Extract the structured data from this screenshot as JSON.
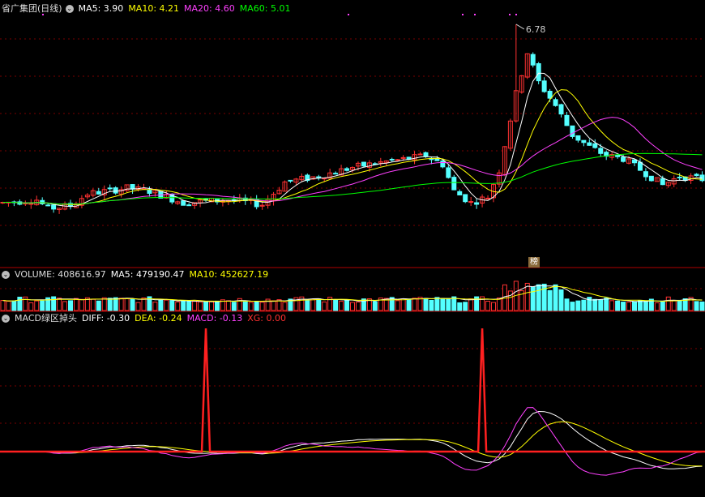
{
  "main": {
    "title": "省广集团(日线)",
    "ma5_label": "MA5: 3.90",
    "ma10_label": "MA10: 4.21",
    "ma20_label": "MA20: 4.60",
    "ma60_label": "MA60: 5.01",
    "high_label": "6.78",
    "badge_label": "榜"
  },
  "volume": {
    "label": "VOLUME: 408616.97",
    "ma5_label": "MA5: 479190.47",
    "ma10_label": "MA10: 452627.19"
  },
  "macd": {
    "title": "MACD绿区掉头",
    "diff_label": "DIFF: -0.30",
    "dea_label": "DEA: -0.24",
    "macd_label": "MACD: -0.13",
    "xg_label": "XG: 0.00"
  },
  "colors": {
    "up": "#ff3232",
    "down": "#54ffff",
    "ma5": "#ffffff",
    "ma10": "#ffff00",
    "ma20": "#ff40ff",
    "ma60": "#00ff00",
    "grid": "#7a0000",
    "signal": "#ff2020"
  },
  "chart_data": [
    {
      "type": "candlestick",
      "title": "省广集团(日线)",
      "series": [
        {
          "name": "MA5",
          "last": 3.9
        },
        {
          "name": "MA10",
          "last": 4.21
        },
        {
          "name": "MA20",
          "last": 4.6
        },
        {
          "name": "MA60",
          "last": 5.01
        }
      ],
      "annotations": [
        {
          "text": "6.78",
          "meaning": "period high"
        }
      ]
    },
    {
      "type": "bar",
      "title": "VOLUME",
      "series": [
        {
          "name": "VOLUME",
          "last": 408616.97
        },
        {
          "name": "MA5",
          "last": 479190.47
        },
        {
          "name": "MA10",
          "last": 452627.19
        }
      ]
    },
    {
      "type": "line",
      "title": "MACD绿区掉头",
      "series": [
        {
          "name": "DIFF",
          "last": -0.3
        },
        {
          "name": "DEA",
          "last": -0.24
        },
        {
          "name": "MACD",
          "last": -0.13
        },
        {
          "name": "XG",
          "last": 0.0
        }
      ]
    }
  ]
}
